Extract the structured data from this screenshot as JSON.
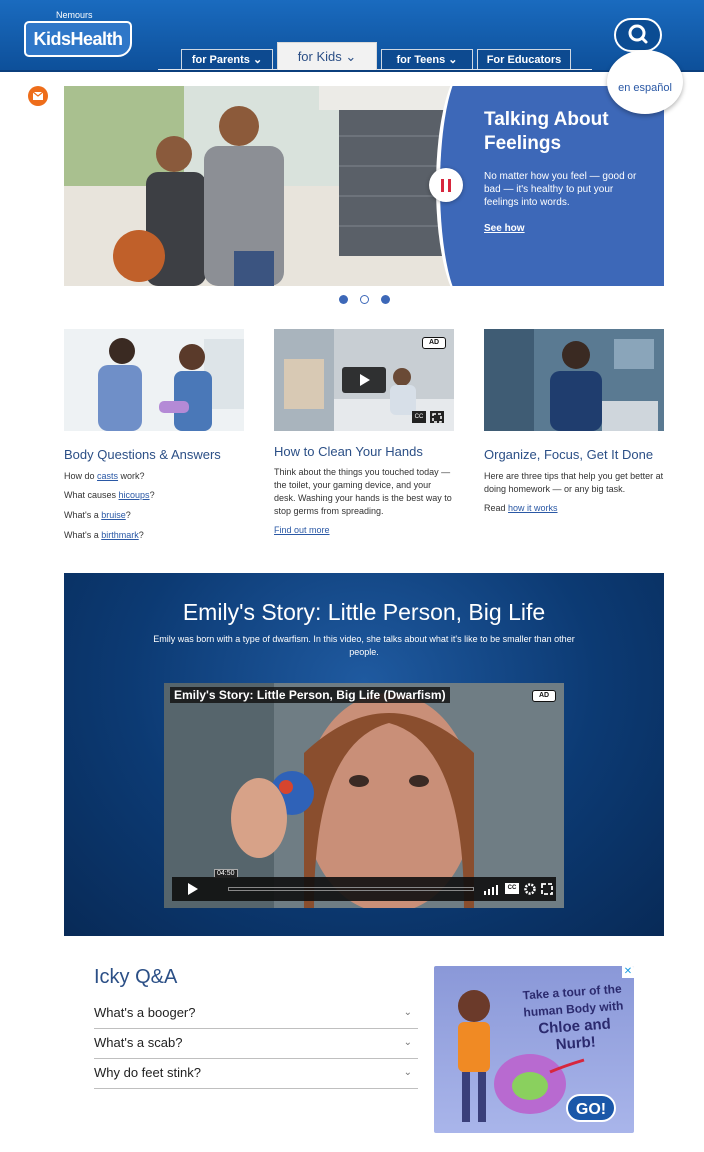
{
  "header": {
    "brand_small": "Nemours",
    "brand": "KidsHealth",
    "tabs": [
      {
        "label": "for Parents"
      },
      {
        "label": "for Kids"
      },
      {
        "label": "for Teens"
      },
      {
        "label": "For Educators"
      }
    ],
    "espanol": "en español"
  },
  "hero": {
    "title": "Talking About Feelings",
    "description": "No matter how you feel — good or bad — it's healthy to put your feelings into words.",
    "link": "See how",
    "dots": 3,
    "active_dot": 2
  },
  "cards": [
    {
      "title": "Body Questions & Answers",
      "lines": [
        {
          "before": "How do ",
          "link": "casts",
          "after": " work?"
        },
        {
          "before": "What causes ",
          "link": "hicoups",
          "after": "?"
        },
        {
          "before": "What's a ",
          "link": "bruise",
          "after": "?"
        },
        {
          "before": "What's a ",
          "link": "birthmark",
          "after": "?"
        }
      ]
    },
    {
      "title": "How to Clean Your Hands",
      "text": "Think about the things you touched today — the toilet, your gaming device, and your desk. Washing your hands is the best way to stop germs from spreading.",
      "link": "Find out more",
      "badge": "AD"
    },
    {
      "title": "Organize, Focus, Get It Done",
      "text": "Here are three tips that help you get better at doing homework — or any big task.",
      "read_prefix": "Read ",
      "link": "how it works"
    }
  ],
  "video_section": {
    "title": "Emily's Story: Little Person, Big Life",
    "description": "Emily was born with a type of dwarfism. In this video, she talks about what it's like to be smaller than other people.",
    "video_title": "Emily's Story: Little Person, Big Life (Dwarfism)",
    "badge": "AD",
    "time": "04:50",
    "cc": "CC"
  },
  "icky": {
    "title": "Icky Q&A",
    "questions": [
      "What's a booger?",
      "What's a scab?",
      "Why do feet stink?"
    ]
  },
  "ad": {
    "text_line1": "Take a tour of the",
    "text_line2": "human Body with",
    "text_line3": "Chloe and Nurb!",
    "button": "GO!"
  },
  "colors": {
    "header_blue": "#1a6bbf",
    "accent_blue": "#2b4f86",
    "hero_panel": "#3d68b8",
    "pause_red": "#d7263d",
    "mail_orange": "#ee6d1a"
  }
}
